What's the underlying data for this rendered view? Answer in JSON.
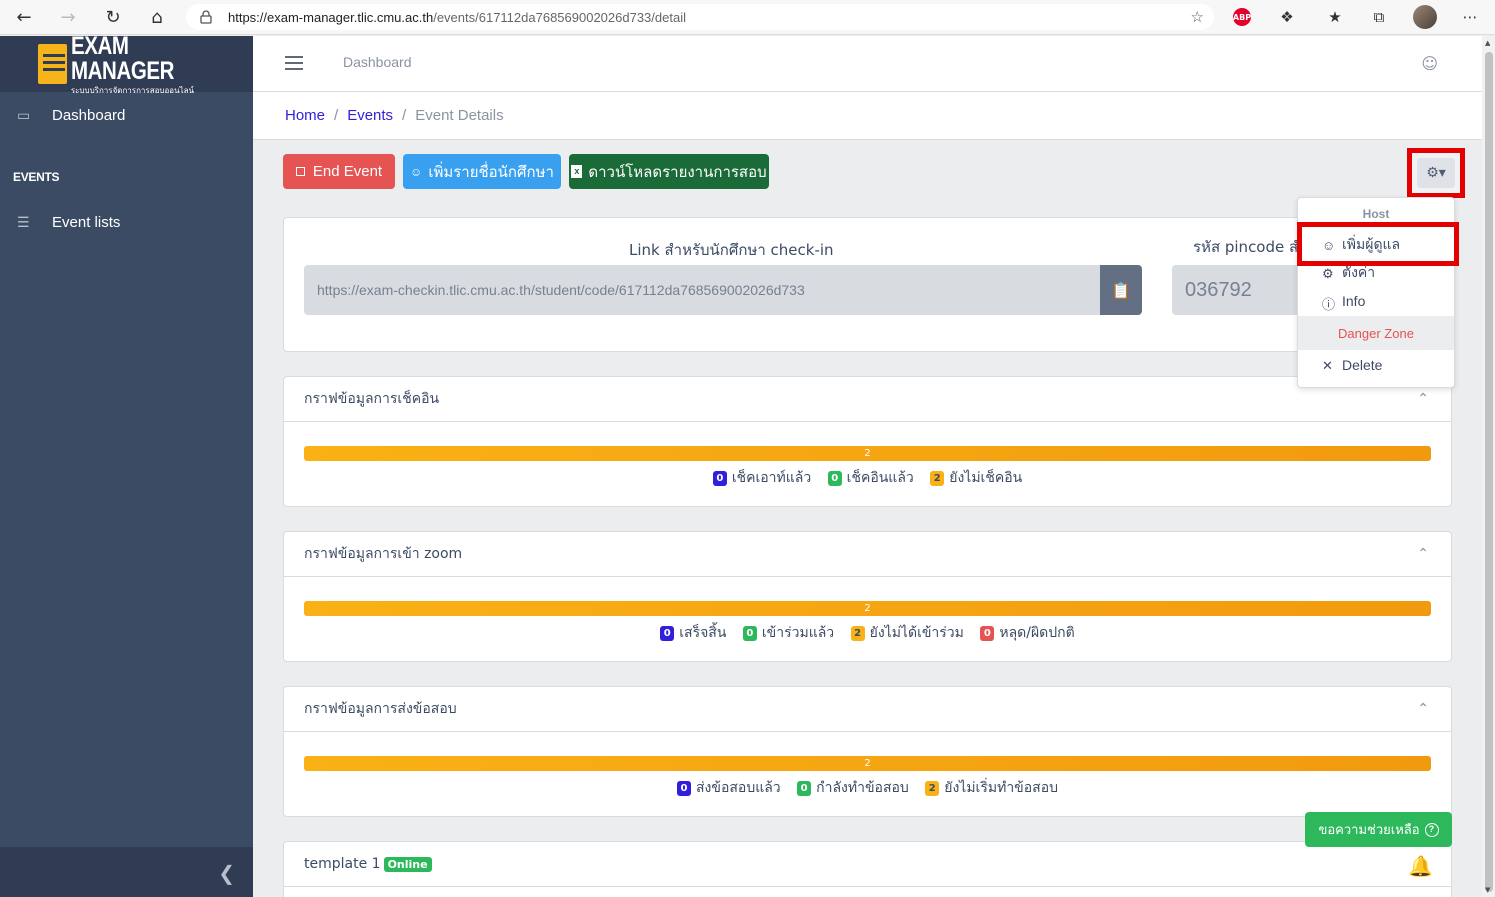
{
  "browser": {
    "url_host": "https://exam-manager.tlic.cmu.ac.th",
    "url_path": "/events/617112da768569002026d733/detail",
    "abp_label": "ABP"
  },
  "sidebar": {
    "brand_title": "EXAM MANAGER",
    "brand_subtitle": "ระบบบริการจัดการการสอบออนไลน์",
    "dashboard_label": "Dashboard",
    "section_title": "EVENTS",
    "event_lists_label": "Event lists"
  },
  "header": {
    "dashboard_link": "Dashboard"
  },
  "breadcrumb": {
    "home": "Home",
    "events": "Events",
    "current": "Event Details",
    "sep": "/"
  },
  "actions": {
    "end_event": "End Event",
    "add_students": "เพิ่มรายชื่อนักศึกษา",
    "download_report": "ดาวน์โหลดรายงานการสอบ"
  },
  "dropdown": {
    "host_header": "Host",
    "add_admin": "เพิ่มผู้ดูแล",
    "settings": "ตั้งค่า",
    "info": "Info",
    "danger_zone": "Danger Zone",
    "delete": "Delete"
  },
  "link_card": {
    "link_label": "Link สำหรับนักศึกษา check-in",
    "link_value": "https://exam-checkin.tlic.cmu.ac.th/student/code/617112da768569002026d733",
    "pin_label": "รหัส pincode สำ",
    "pin_value": "036792"
  },
  "checkin_card": {
    "title": "กราฟข้อมูลการเช็คอิน",
    "bar_value": "2",
    "legend": [
      {
        "count": "0",
        "label": "เช็คเอาท์แล้ว",
        "color": "blue"
      },
      {
        "count": "0",
        "label": "เช็คอินแล้ว",
        "color": "green"
      },
      {
        "count": "2",
        "label": "ยังไม่เช็คอิน",
        "color": "yellow"
      }
    ]
  },
  "zoom_card": {
    "title": "กราฟข้อมูลการเข้า zoom",
    "bar_value": "2",
    "legend": [
      {
        "count": "0",
        "label": "เสร็จสิ้น",
        "color": "blue"
      },
      {
        "count": "0",
        "label": "เข้าร่วมแล้ว",
        "color": "green"
      },
      {
        "count": "2",
        "label": "ยังไม่ได้เข้าร่วม",
        "color": "yellow"
      },
      {
        "count": "0",
        "label": "หลุด/ผิดปกติ",
        "color": "red"
      }
    ]
  },
  "submit_card": {
    "title": "กราฟข้อมูลการส่งข้อสอบ",
    "bar_value": "2",
    "legend": [
      {
        "count": "0",
        "label": "ส่งข้อสอบแล้ว",
        "color": "blue"
      },
      {
        "count": "0",
        "label": "กำลังทำข้อสอบ",
        "color": "green"
      },
      {
        "count": "2",
        "label": "ยังไม่เริ่มทำข้อสอบ",
        "color": "yellow"
      }
    ]
  },
  "template_card": {
    "title": "template 1",
    "status": "Online"
  },
  "help": {
    "label": "ขอความช่วยเหลือ",
    "q": "?"
  },
  "colors": {
    "sidebar": "#3c4b64",
    "danger": "#e55353",
    "info": "#39a0f0",
    "success": "#2eb85c",
    "warning": "#f9b115",
    "primary": "#321fdb",
    "highlight": "#e20000"
  }
}
